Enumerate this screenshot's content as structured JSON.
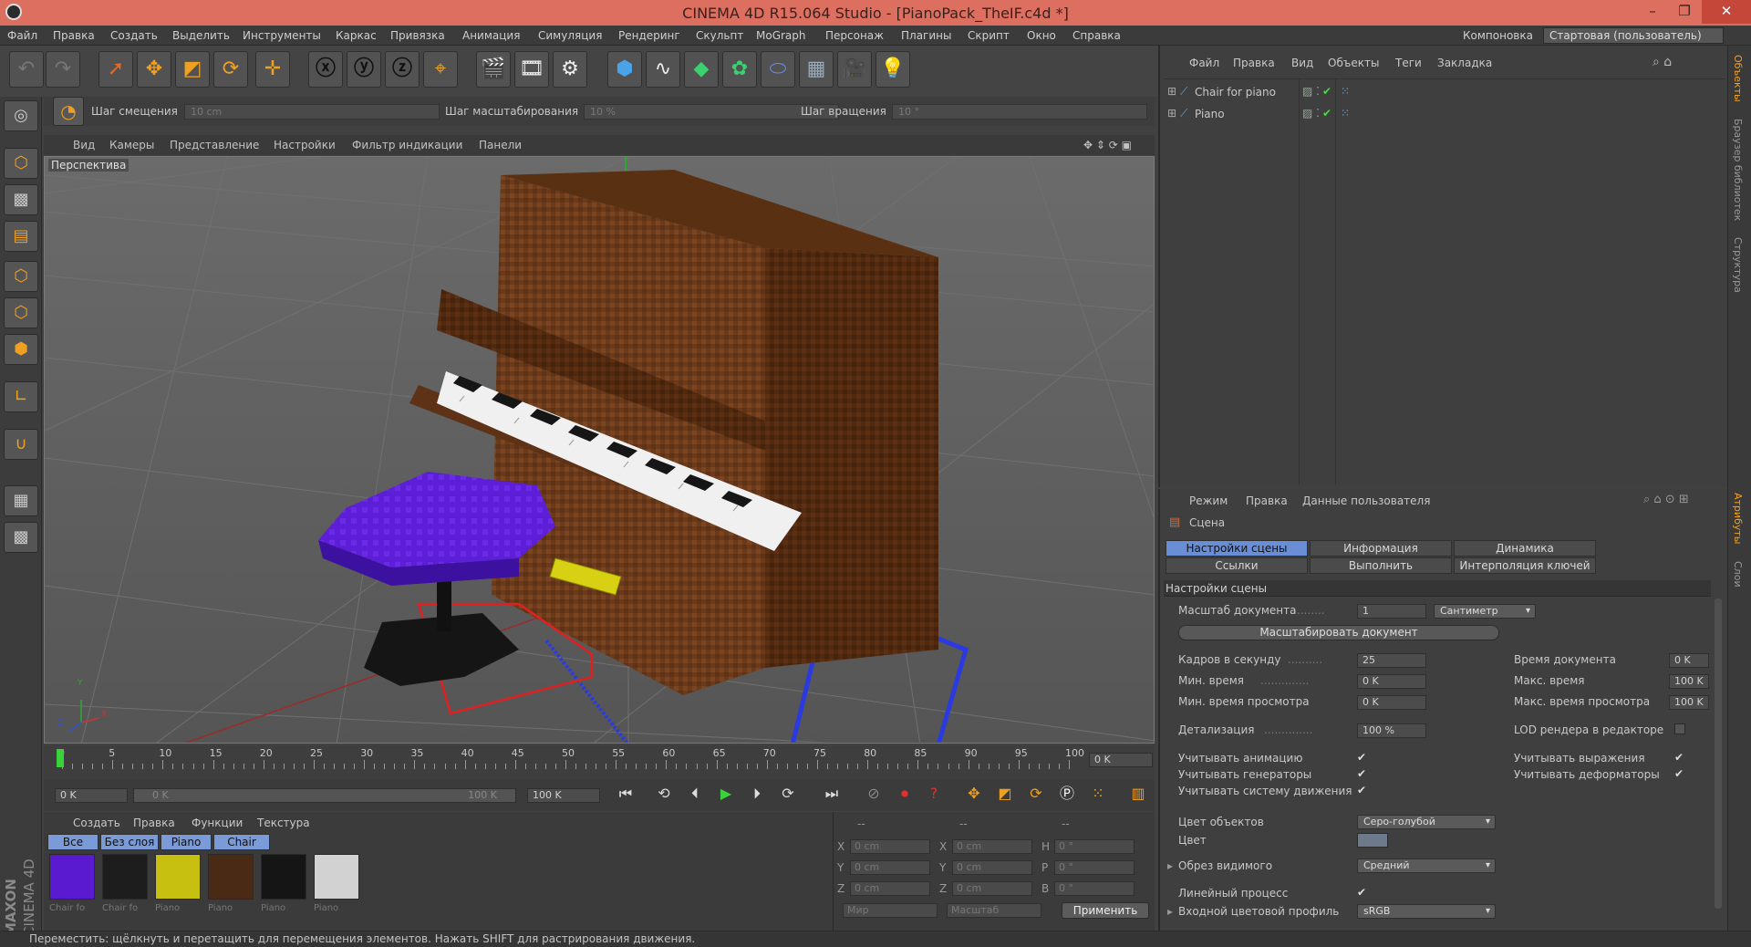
{
  "window": {
    "title": "CINEMA 4D R15.064 Studio - [PianoPack_TheIF.c4d *]",
    "layout_label": "Компоновка",
    "layout_value": "Стартовая (пользователь)"
  },
  "menu": [
    "Файл",
    "Правка",
    "Создать",
    "Выделить",
    "Инструменты",
    "Каркас",
    "Привязка",
    "Анимация",
    "Симуляция",
    "Рендеринг",
    "Скульпт",
    "MoGraph",
    "Персонаж",
    "Плагины",
    "Скрипт",
    "Окно",
    "Справка"
  ],
  "steps": {
    "move_label": "Шаг смещения",
    "move_value": "10 cm",
    "scale_label": "Шаг масштабирования",
    "scale_value": "10 %",
    "rot_label": "Шаг вращения",
    "rot_value": "10 °"
  },
  "viewport": {
    "menu": [
      "Вид",
      "Камеры",
      "Представление",
      "Настройки",
      "Фильтр индикации",
      "Панели"
    ],
    "label": "Перспектива",
    "axis": {
      "y": "Y",
      "x": "X",
      "z": "Z"
    }
  },
  "timeline": {
    "ticks": [
      "0",
      "5",
      "10",
      "15",
      "20",
      "25",
      "30",
      "35",
      "40",
      "45",
      "50",
      "55",
      "60",
      "65",
      "70",
      "75",
      "80",
      "85",
      "90",
      "95",
      "100"
    ],
    "frame": "0 K",
    "start": "0 K",
    "range_start": "0 K",
    "range_end": "100 K",
    "end": "100 K"
  },
  "materials": {
    "menu": [
      "Создать",
      "Правка",
      "Функции",
      "Текстура"
    ],
    "tabs": [
      "Все",
      "Без слоя",
      "Piano",
      "Chair"
    ],
    "items": [
      {
        "name": "Chair fo",
        "color": "#5a1bd0"
      },
      {
        "name": "Chair fo",
        "color": "#1d1d1d"
      },
      {
        "name": "Piano",
        "color": "#c8c010"
      },
      {
        "name": "Piano",
        "color": "#4a2a14"
      },
      {
        "name": "Piano",
        "color": "#151515"
      },
      {
        "name": "Piano",
        "color": "#d2d2d2"
      }
    ]
  },
  "coords": {
    "hdr": [
      "--",
      "--",
      "--"
    ],
    "rows": [
      {
        "a": "X",
        "v1": "0 cm",
        "b": "X",
        "v2": "0 cm",
        "c": "H",
        "v3": "0 °"
      },
      {
        "a": "Y",
        "v1": "0 cm",
        "b": "Y",
        "v2": "0 cm",
        "c": "P",
        "v3": "0 °"
      },
      {
        "a": "Z",
        "v1": "0 cm",
        "b": "Z",
        "v2": "0 cm",
        "c": "B",
        "v3": "0 °"
      }
    ],
    "world": "Мир",
    "scale": "Масштаб",
    "apply": "Применить"
  },
  "objects": {
    "menu": [
      "Файл",
      "Правка",
      "Вид",
      "Объекты",
      "Теги",
      "Закладка"
    ],
    "items": [
      "Chair for piano",
      "Piano"
    ]
  },
  "attributes": {
    "menu": [
      "Режим",
      "Правка",
      "Данные пользователя"
    ],
    "title": "Сцена",
    "tabs": [
      "Настройки сцены",
      "Информация",
      "Динамика",
      "Ссылки",
      "Выполнить",
      "Интерполяция ключей"
    ],
    "section": "Настройки сцены",
    "doc_scale_label": "Масштаб документа",
    "doc_scale_value": "1",
    "doc_scale_unit": "Сантиметр",
    "scale_doc_btn": "Масштабировать документ",
    "fps_label": "Кадров в секунду",
    "fps_value": "25",
    "min_time_label": "Мин. время",
    "min_time_value": "0 K",
    "min_preview_label": "Мин. время просмотра",
    "min_preview_value": "0 K",
    "doc_time_label": "Время документа",
    "doc_time_value": "0 K",
    "max_time_label": "Макс. время",
    "max_time_value": "100 K",
    "max_preview_label": "Макс. время просмотра",
    "max_preview_value": "100 K",
    "detail_label": "Детализация",
    "detail_value": "100 %",
    "lod_label": "LOD рендера в редакторе",
    "use_anim": "Учитывать анимацию",
    "use_expr": "Учитывать выражения",
    "use_gen": "Учитывать генераторы",
    "use_deform": "Учитывать деформаторы",
    "use_motion": "Учитывать систему движения",
    "obj_color_label": "Цвет объектов",
    "obj_color_value": "Серо-голубой",
    "color_label": "Цвет",
    "clip_label": "Обрез видимого",
    "clip_value": "Средний",
    "linear_label": "Линейный процесс",
    "profile_label": "Входной цветовой профиль",
    "profile_value": "sRGB"
  },
  "sidetabs": [
    "Объекты",
    "Браузер библиотек",
    "Структура",
    "Атрибуты",
    "Слои"
  ],
  "brand": {
    "a": "MAXON",
    "b": "CINEMA 4D"
  },
  "status": "Переместить: щёлкнуть и перетащить для перемещения элементов. Нажать SHIFT для растрирования движения."
}
